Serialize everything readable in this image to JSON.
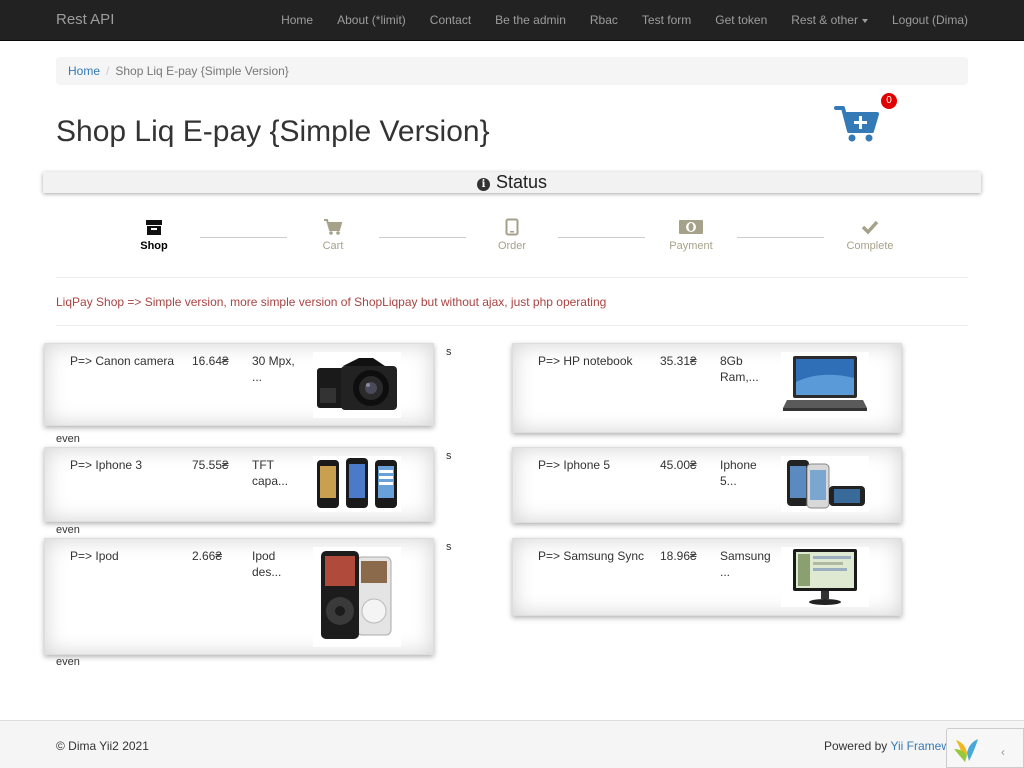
{
  "nav": {
    "brand": "Rest API",
    "items": [
      {
        "label": "Home"
      },
      {
        "label": "About (*limit)"
      },
      {
        "label": "Contact"
      },
      {
        "label": "Be the admin"
      },
      {
        "label": "Rbac"
      },
      {
        "label": "Test form"
      },
      {
        "label": "Get token"
      },
      {
        "label": "Rest & other"
      },
      {
        "label": "Logout (Dima)"
      }
    ]
  },
  "breadcrumb": {
    "home": "Home",
    "separator": "/",
    "current": "Shop Liq E-pay {Simple Version}"
  },
  "page": {
    "title": "Shop Liq E-pay {Simple Version}",
    "cart_count": "0",
    "status_title": "Status",
    "description": "LiqPay Shop => Simple version, more simple version of ShopLiqpay but without ajax, just php operating"
  },
  "steps": [
    {
      "label": "Shop",
      "icon": "archive-icon",
      "active": true
    },
    {
      "label": "Cart",
      "icon": "cart-icon",
      "active": false
    },
    {
      "label": "Order",
      "icon": "tablet-icon",
      "active": false
    },
    {
      "label": "Payment",
      "icon": "money-icon",
      "active": false
    },
    {
      "label": "Complete",
      "icon": "check-icon",
      "active": false
    }
  ],
  "products": [
    {
      "name": "P=> Canon camera",
      "price": "16.64₴",
      "desc": "30 Mpx, ...",
      "image": "camera-image"
    },
    {
      "name": "P=> HP notebook",
      "price": "35.31₴",
      "desc": "8Gb Ram,...",
      "image": "laptop-image"
    },
    {
      "name": "P=> Iphone 3",
      "price": "75.55₴",
      "desc": "TFT capa...",
      "image": "phones-image"
    },
    {
      "name": "P=> Iphone 5",
      "price": "45.00₴",
      "desc": "Iphone 5...",
      "image": "iphone5-image"
    },
    {
      "name": "P=> Ipod",
      "price": "2.66₴",
      "desc": "Ipod des...",
      "image": "ipod-image"
    },
    {
      "name": "P=> Samsung Sync",
      "price": "18.96₴",
      "desc": "Samsung ...",
      "image": "monitor-image"
    }
  ],
  "markers": {
    "s": "s",
    "even": "even"
  },
  "footer": {
    "copyright": "© Dima Yii2 2021",
    "powered_prefix": "Powered by",
    "powered_link": "Yii Framew"
  },
  "colors": {
    "navbar": "#222222",
    "link": "#337ab7",
    "cart": "#337ab7",
    "badge": "#e00000",
    "step_inactive": "#a6a28a",
    "description": "#a94442"
  }
}
